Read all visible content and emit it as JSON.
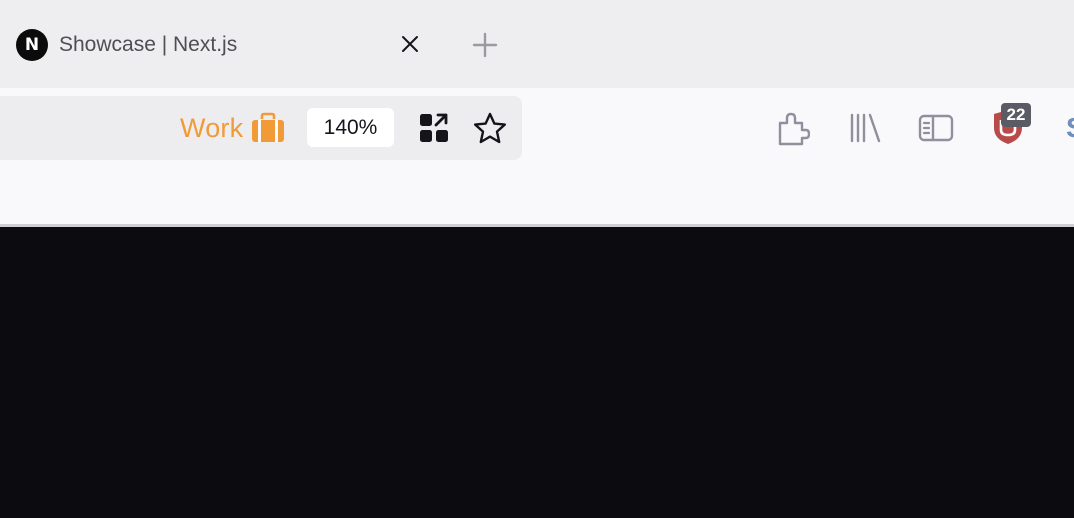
{
  "tab": {
    "favicon_letter": "N",
    "title": "Showcase | Next.js",
    "close_icon": "close-icon",
    "new_tab_icon": "plus-icon"
  },
  "urlbar": {
    "container_name": "Work",
    "container_icon": "briefcase-icon",
    "container_color": "#f19a38",
    "zoom": "140%",
    "qr_icon": "qr-code-icon",
    "bookmark_icon": "star-icon"
  },
  "toolbar": {
    "extensions_icon": "puzzle-icon",
    "library_icon": "library-icon",
    "sidebar_icon": "sidebar-icon",
    "ublock_icon": "ublock-shield-icon",
    "ublock_badge": "22",
    "partial_icon_letter": "S"
  },
  "content": {
    "background": "#0c0c10"
  }
}
